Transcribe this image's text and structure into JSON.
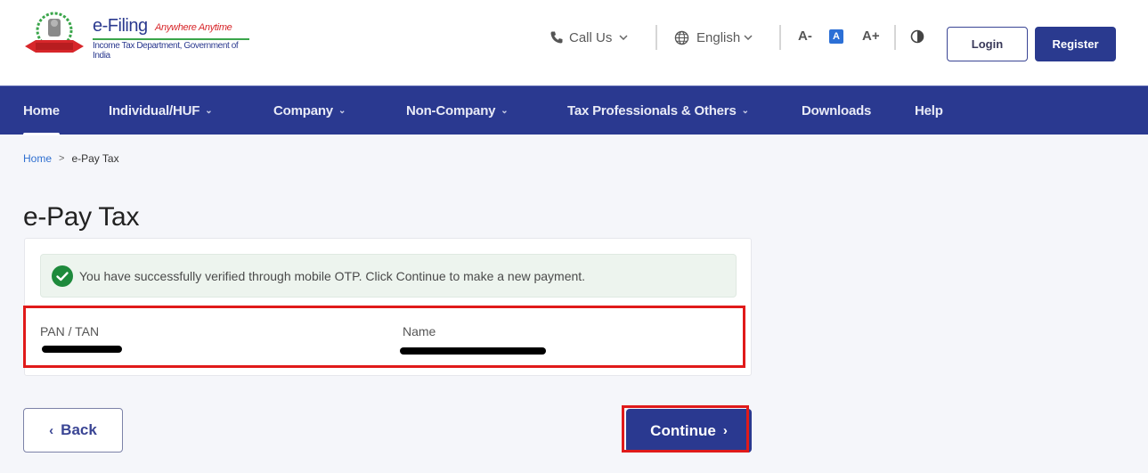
{
  "header": {
    "brand_title": "e-Filing",
    "brand_tagline": "Anywhere Anytime",
    "brand_subtitle": "Income Tax Department, Government of India",
    "call_us": "Call Us",
    "language": "English",
    "font_decrease": "A-",
    "font_default": "A",
    "font_increase": "A+",
    "login": "Login",
    "register": "Register"
  },
  "nav": {
    "items": [
      {
        "label": "Home",
        "dropdown": false,
        "active": true
      },
      {
        "label": "Individual/HUF",
        "dropdown": true
      },
      {
        "label": "Company",
        "dropdown": true
      },
      {
        "label": "Non-Company",
        "dropdown": true
      },
      {
        "label": "Tax Professionals & Others",
        "dropdown": true
      },
      {
        "label": "Downloads",
        "dropdown": false
      },
      {
        "label": "Help",
        "dropdown": false
      }
    ],
    "chevron": "⌄"
  },
  "breadcrumb": {
    "home": "Home",
    "separator": ">",
    "current": "e-Pay Tax"
  },
  "page": {
    "title": "e-Pay Tax",
    "alert": "You have successfully verified through mobile OTP. Click Continue to make a new payment.",
    "fields": [
      {
        "label": "PAN / TAN",
        "value": "[redacted]"
      },
      {
        "label": "Name",
        "value": "[redacted]"
      }
    ],
    "back": "Back",
    "continue": "Continue",
    "back_chevron": "‹",
    "continue_chevron": "›"
  },
  "colors": {
    "primary": "#2a3990",
    "success": "#1e8a3c",
    "highlight": "#e01a1a",
    "link": "#2f6fd0"
  }
}
